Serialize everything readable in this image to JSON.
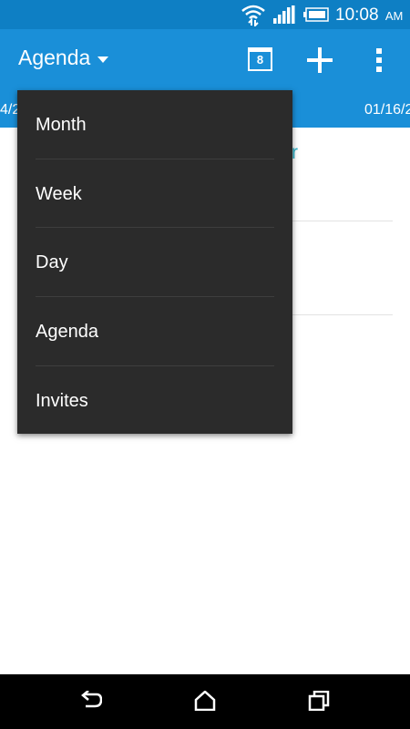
{
  "status_bar": {
    "time": "10:08",
    "ampm": "AM"
  },
  "app_bar": {
    "title": "Agenda"
  },
  "sub_bar": {
    "left_date": "4/2",
    "right_date": "01/16/2"
  },
  "content": {
    "teal_fragment": "r"
  },
  "dropdown_menu": {
    "items": [
      {
        "label": "Month"
      },
      {
        "label": "Week"
      },
      {
        "label": "Day"
      },
      {
        "label": "Agenda"
      },
      {
        "label": "Invites"
      }
    ]
  },
  "calendar_icon_day": "8",
  "colors": {
    "accent": "#1a8fd8",
    "statusbar": "#0e7fc4",
    "menu_bg": "#2b2b2b",
    "teal": "#2fb3c9"
  },
  "icons": [
    "wifi-icon",
    "signal-icon",
    "battery-icon",
    "calendar-today-icon",
    "add-icon",
    "overflow-menu-icon",
    "back-icon",
    "home-icon",
    "recents-icon"
  ]
}
